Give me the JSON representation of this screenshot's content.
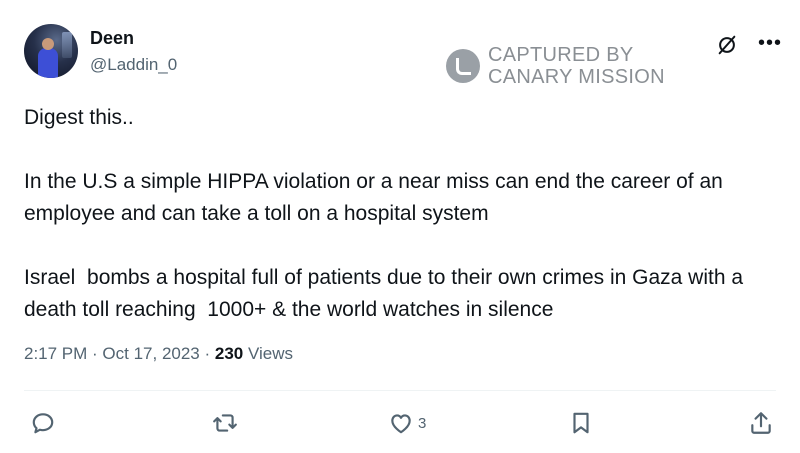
{
  "author": {
    "display_name": "Deen",
    "handle": "@Laddin_0"
  },
  "watermark": {
    "line1": "CAPTURED BY",
    "line2": "CANARY MISSION"
  },
  "tweet": {
    "text": "Digest this..\n\nIn the U.S a simple HIPPA violation or a near miss can end the career of an employee and can take a toll on a hospital system\n\nIsrael  bombs a hospital full of patients due to their own crimes in Gaza with a death toll reaching  1000+ & the world watches in silence"
  },
  "meta": {
    "time": "2:17 PM",
    "separator1": " · ",
    "date": "Oct 17, 2023",
    "separator2": " · ",
    "views_count": "230",
    "views_label": " Views"
  },
  "actions": {
    "likes_count": "3"
  },
  "icons": {
    "reply": "reply-icon",
    "retweet": "retweet-icon",
    "like": "like-icon",
    "bookmark": "bookmark-icon",
    "share": "share-icon",
    "grok": "grok-icon",
    "more": "more-icon"
  }
}
